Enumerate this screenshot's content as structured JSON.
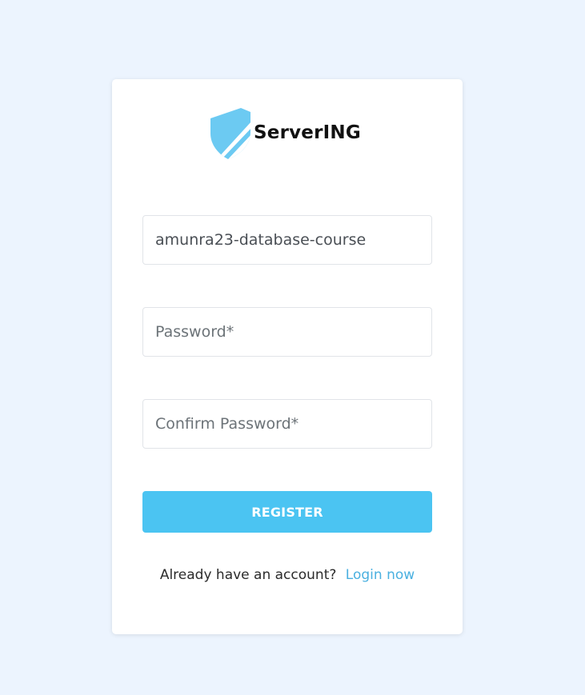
{
  "brand": {
    "name": "ServerING",
    "logo_icon": "shield-icon",
    "accent_color": "#4bc4f2"
  },
  "form": {
    "username_value": "amunra23-database-course",
    "password_placeholder": "Password*",
    "confirm_password_placeholder": "Confirm Password*",
    "register_label": "REGISTER"
  },
  "footer": {
    "prompt": "Already have an account?",
    "login_link": "Login now"
  }
}
